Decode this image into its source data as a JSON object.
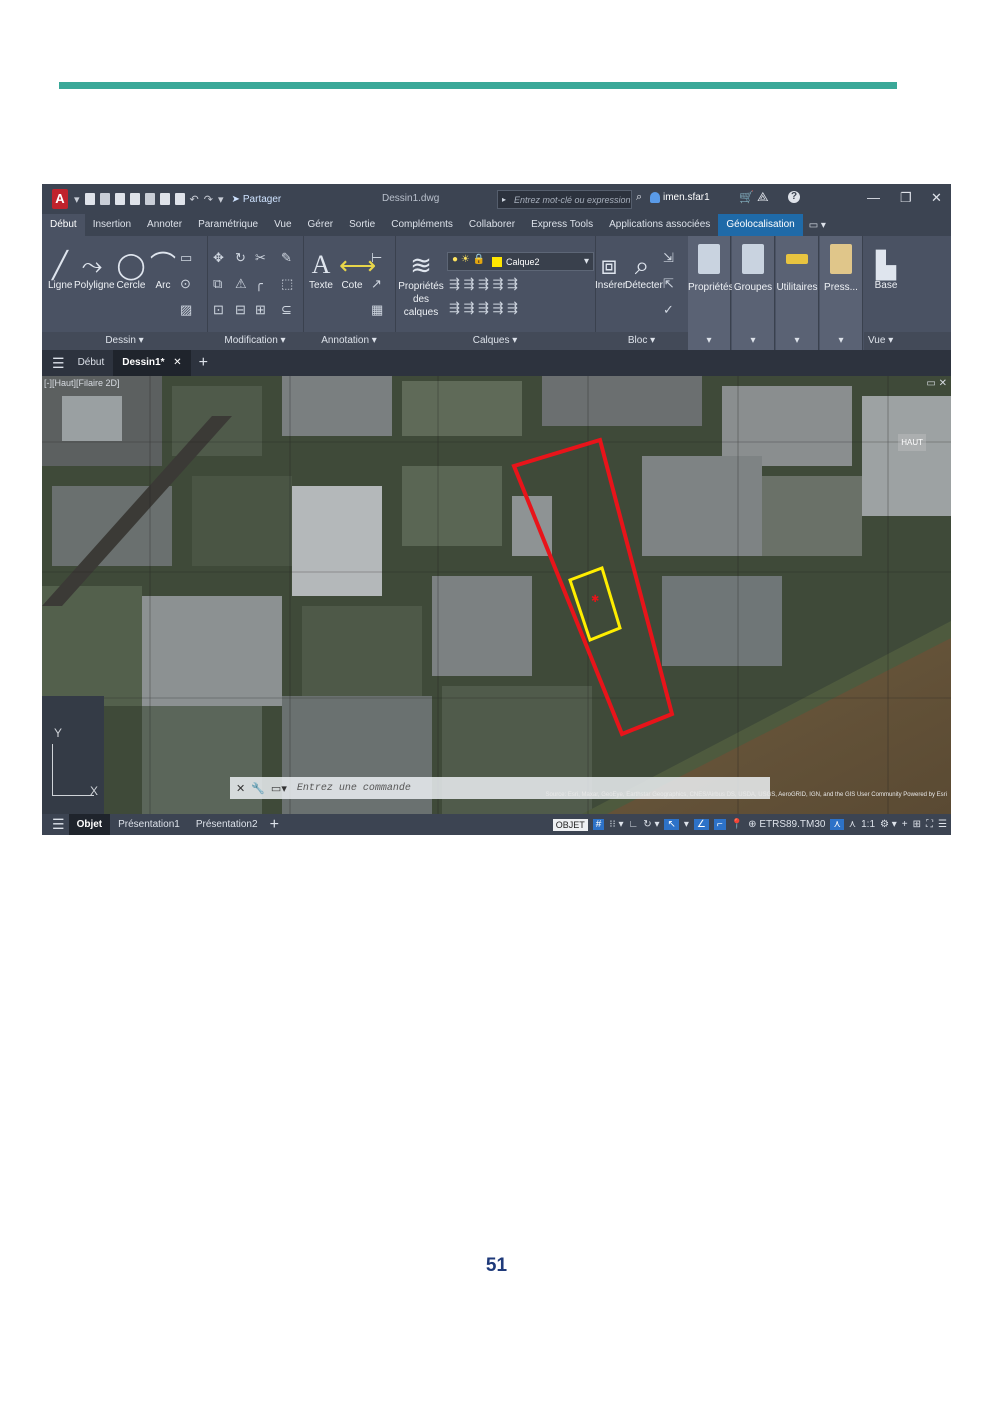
{
  "page": {
    "number": "51",
    "accent": "#3aa898"
  },
  "titlebar": {
    "logo": "A",
    "share_label": "Partager",
    "doc_title": "Dessin1.dwg",
    "search_placeholder": "Entrez mot-clé ou expression",
    "user": "imen.sfar1"
  },
  "ribbon_tabs": [
    "Début",
    "Insertion",
    "Annoter",
    "Paramétrique",
    "Vue",
    "Gérer",
    "Sortie",
    "Compléments",
    "Collaborer",
    "Express Tools",
    "Applications associées",
    "Géolocalisation"
  ],
  "ribbon": {
    "dessin": {
      "tools": [
        "Ligne",
        "Polyligne",
        "Cercle",
        "Arc"
      ],
      "footer": "Dessin ▾"
    },
    "modification": {
      "footer": "Modification ▾"
    },
    "annotation": {
      "tools": [
        "Texte",
        "Cote"
      ],
      "footer": "Annotation ▾"
    },
    "calques": {
      "tool_line1": "Propriétés",
      "tool_line2": "des calques",
      "current_layer": "Calque2",
      "layer_color": "#ffe600",
      "footer": "Calques ▾"
    },
    "bloc": {
      "tools": [
        "Insérer",
        "Détecter"
      ],
      "footer": "Bloc ▾"
    },
    "side_panels": [
      "Propriétés",
      "Groupes",
      "Utilitaires",
      "Press..."
    ],
    "vue": {
      "tool": "Base",
      "footer": "Vue ▾"
    }
  },
  "file_tabs": [
    "Début",
    "Dessin1*"
  ],
  "viewport": {
    "label": "[-][Haut][Filaire 2D]",
    "viewcube": "HAUT",
    "ucs_y": "Y",
    "ucs_x": "X",
    "command_placeholder": "Entrez une commande",
    "attribution": "Source: Esri, Maxar, GeoEye, Earthstar Geographics, CNES/Airbus DS, USDA, USGS, AeroGRID, IGN, and the GIS User Community Powered by Esri",
    "outline_colors": {
      "site": "#e8141a",
      "parcel": "#ffee00"
    }
  },
  "statusbar": {
    "layout_tabs": [
      "Objet",
      "Présentation1",
      "Présentation2"
    ],
    "model": "OBJET",
    "coord_system": "ETRS89.TM30",
    "scale": "1:1"
  }
}
